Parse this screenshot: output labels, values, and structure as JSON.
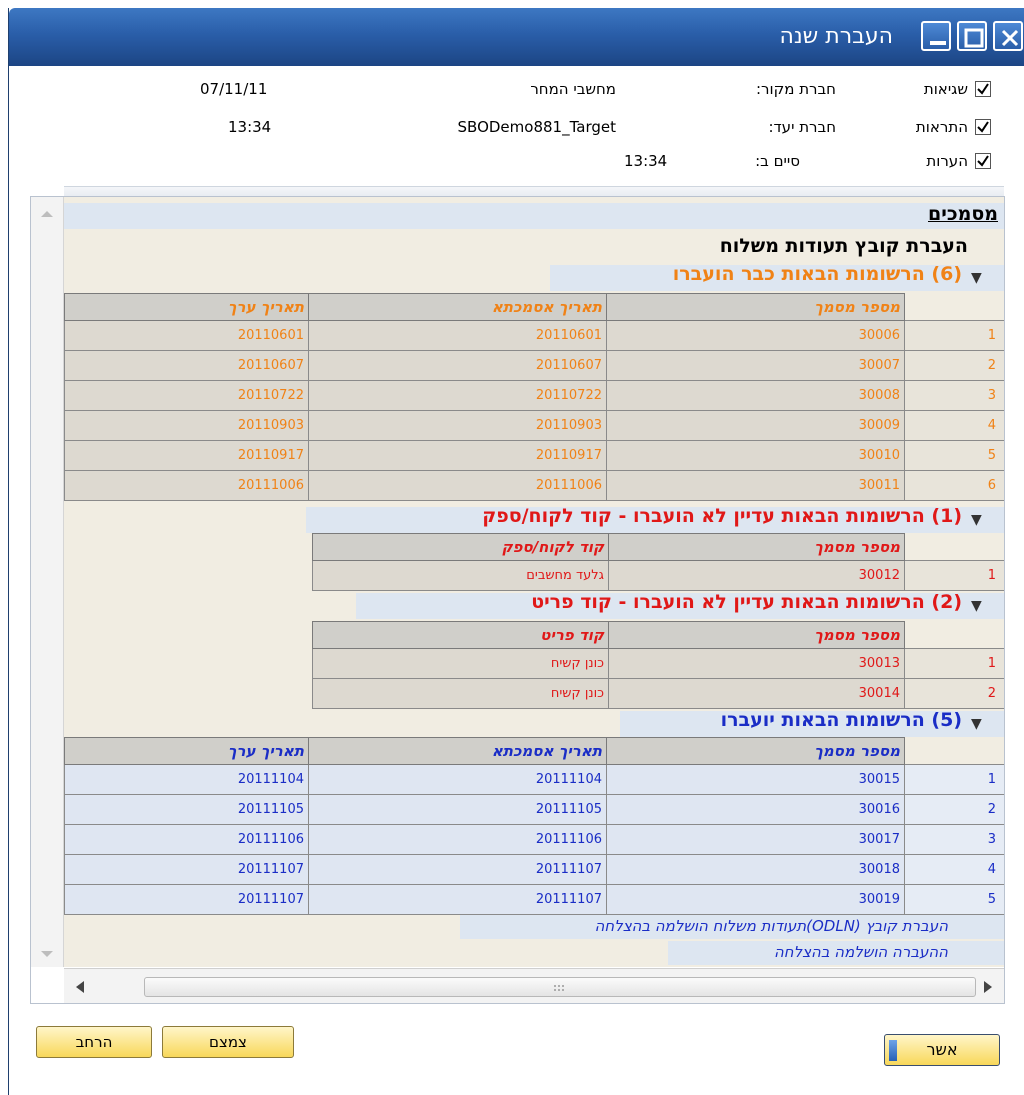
{
  "window": {
    "title": "העברת שנה"
  },
  "header": {
    "checkboxes": [
      {
        "label": "שגיאות",
        "checked": true
      },
      {
        "label": "התראות",
        "checked": true
      },
      {
        "label": "הערות",
        "checked": true
      }
    ],
    "source_label": "חברת מקור:",
    "source_value": "מחשבי המחר",
    "source_date": "07/11/11",
    "target_label": "חברת יעד:",
    "target_value": "SBODemo881_Target",
    "target_time": "13:34",
    "ended_label": "סיים ב:",
    "ended_value": "13:34"
  },
  "log": {
    "documents_title": "מסמכים",
    "transfer_title": "העברת קובץ תעודות משלוח",
    "sections": [
      {
        "title": "(6) הרשומות הבאות כבר הועברו",
        "color": "#f08216",
        "columns": [
          "מספר מסמך",
          "תאריך אסמכתא",
          "תאריך ערך"
        ],
        "rows": [
          [
            "1",
            "30006",
            "20110601",
            "20110601"
          ],
          [
            "2",
            "30007",
            "20110607",
            "20110607"
          ],
          [
            "3",
            "30008",
            "20110722",
            "20110722"
          ],
          [
            "4",
            "30009",
            "20110903",
            "20110903"
          ],
          [
            "5",
            "30010",
            "20110917",
            "20110917"
          ],
          [
            "6",
            "30011",
            "20111006",
            "20111006"
          ]
        ]
      },
      {
        "title": "(1) הרשומות הבאות עדיין לא הועברו - קוד לקוח/ספק",
        "color": "#e01818",
        "columns": [
          "מספר מסמך",
          "קוד לקוח/ספק"
        ],
        "rows": [
          [
            "1",
            "30012",
            "גלעד מחשבים"
          ]
        ]
      },
      {
        "title": "(2) הרשומות הבאות עדיין לא הועברו - קוד פריט",
        "color": "#e01818",
        "columns": [
          "מספר מסמך",
          "קוד פריט"
        ],
        "rows": [
          [
            "1",
            "30013",
            "כונן קשיח"
          ],
          [
            "2",
            "30014",
            "כונן קשיח"
          ]
        ]
      },
      {
        "title": "(5) הרשומות הבאות יועברו",
        "color": "#1a2dc6",
        "columns": [
          "מספר מסמך",
          "תאריך אסמכתא",
          "תאריך ערך"
        ],
        "rows": [
          [
            "1",
            "30015",
            "20111104",
            "20111104"
          ],
          [
            "2",
            "30016",
            "20111105",
            "20111105"
          ],
          [
            "3",
            "30017",
            "20111106",
            "20111106"
          ],
          [
            "4",
            "30018",
            "20111107",
            "20111107"
          ],
          [
            "5",
            "30019",
            "20111107",
            "20111107"
          ]
        ]
      }
    ],
    "success_lines": [
      "העברת קובץ (ODLN)תעודות משלוח הושלמה בהצלחה",
      "ההעברה הושלמה בהצלחה"
    ]
  },
  "buttons": {
    "ok": "אשר",
    "collapse": "צמצם",
    "expand": "הרחב"
  }
}
